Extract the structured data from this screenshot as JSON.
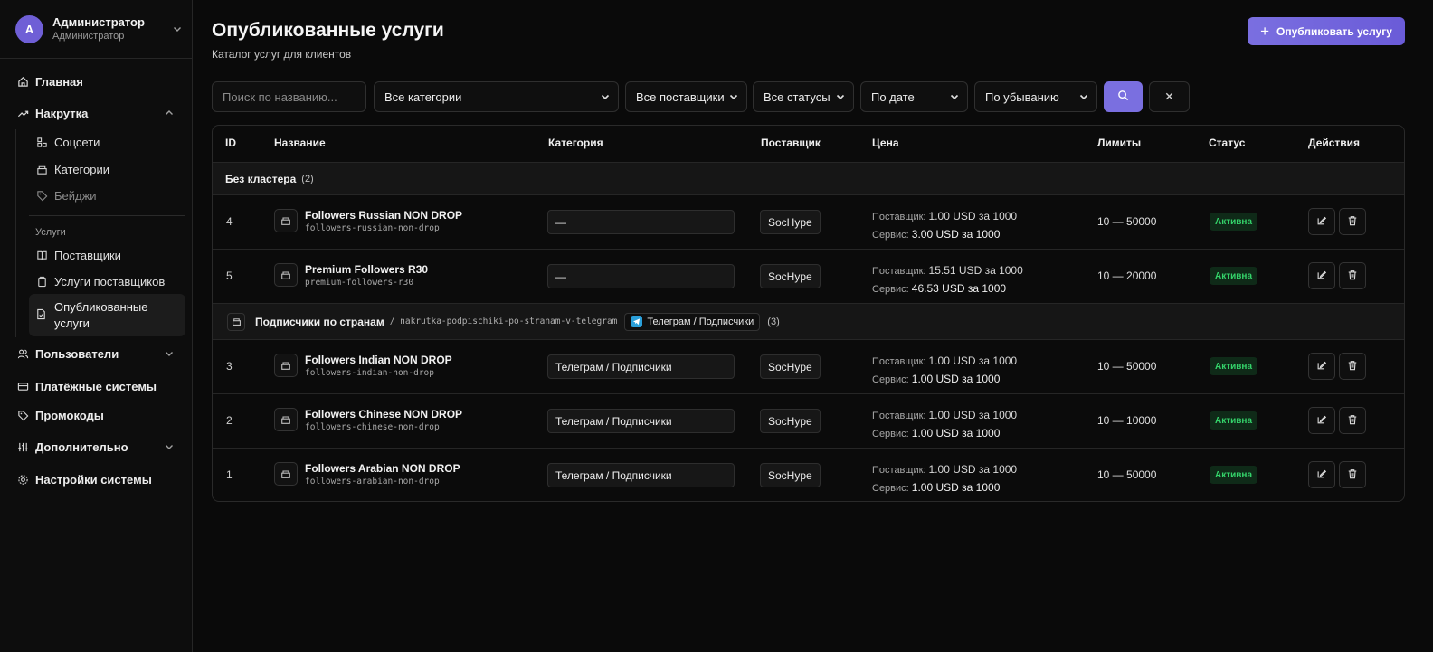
{
  "user": {
    "initial": "A",
    "name": "Администратор",
    "role": "Администратор"
  },
  "nav": {
    "home": "Главная",
    "boost": "Накрутка",
    "sub": {
      "socials": "Соцсети",
      "categories": "Категории",
      "badges": "Бейджи",
      "services_heading": "Услуги",
      "suppliers": "Поставщики",
      "supplier_services": "Услуги поставщиков",
      "published_1": "Опубликованные",
      "published_2": "услуги"
    },
    "users": "Пользователи",
    "payments": "Платёжные системы",
    "promo": "Промокоды",
    "extra": "Дополнительно",
    "settings": "Настройки системы"
  },
  "header": {
    "title": "Опубликованные услуги",
    "subtitle": "Каталог услуг для клиентов",
    "publish_button": "Опубликовать услугу"
  },
  "filters": {
    "search_placeholder": "Поиск по названию...",
    "category": "Все категории",
    "supplier": "Все поставщики",
    "status": "Все статусы",
    "sort_by": "По дате",
    "order": "По убыванию"
  },
  "table": {
    "columns": {
      "id": "ID",
      "name": "Название",
      "category": "Категория",
      "supplier": "Поставщик",
      "price": "Цена",
      "limits": "Лимиты",
      "status": "Статус",
      "actions": "Действия"
    },
    "price_labels": {
      "supplier": "Поставщик:",
      "service": "Сервис:"
    },
    "clusters": [
      {
        "title": "Без кластера",
        "count": "(2)",
        "rows": [
          {
            "id": "4",
            "name": "Followers Russian NON DROP",
            "slug": "followers-russian-non-drop",
            "category": "—",
            "supplier": "SocHype",
            "supplier_price": "1.00 USD за 1000",
            "service_price": "3.00 USD за 1000",
            "limits": "10 — 50000",
            "status": "Активна"
          },
          {
            "id": "5",
            "name": "Premium Followers R30",
            "slug": "premium-followers-r30",
            "category": "—",
            "supplier": "SocHype",
            "supplier_price": "15.51 USD за 1000",
            "service_price": "46.53 USD за 1000",
            "limits": "10 — 20000",
            "status": "Активна"
          }
        ]
      },
      {
        "title": "Подписчики по странам",
        "slug": "/ nakrutka-podpischiki-po-stranam-v-telegram",
        "tag": "Телеграм / Подписчики",
        "count": "(3)",
        "rows": [
          {
            "id": "3",
            "name": "Followers Indian NON DROP",
            "slug": "followers-indian-non-drop",
            "category": "Телеграм / Подписчики",
            "supplier": "SocHype",
            "supplier_price": "1.00 USD за 1000",
            "service_price": "1.00 USD за 1000",
            "limits": "10 — 50000",
            "status": "Активна"
          },
          {
            "id": "2",
            "name": "Followers Chinese NON DROP",
            "slug": "followers-chinese-non-drop",
            "category": "Телеграм / Подписчики",
            "supplier": "SocHype",
            "supplier_price": "1.00 USD за 1000",
            "service_price": "1.00 USD за 1000",
            "limits": "10 — 10000",
            "status": "Активна"
          },
          {
            "id": "1",
            "name": "Followers Arabian NON DROP",
            "slug": "followers-arabian-non-drop",
            "category": "Телеграм / Подписчики",
            "supplier": "SocHype",
            "supplier_price": "1.00 USD за 1000",
            "service_price": "1.00 USD за 1000",
            "limits": "10 — 50000",
            "status": "Активна"
          }
        ]
      }
    ]
  },
  "colors": {
    "accent": "#7a6fe0",
    "status_active": "#34d36a",
    "background": "#0a0a0a"
  }
}
